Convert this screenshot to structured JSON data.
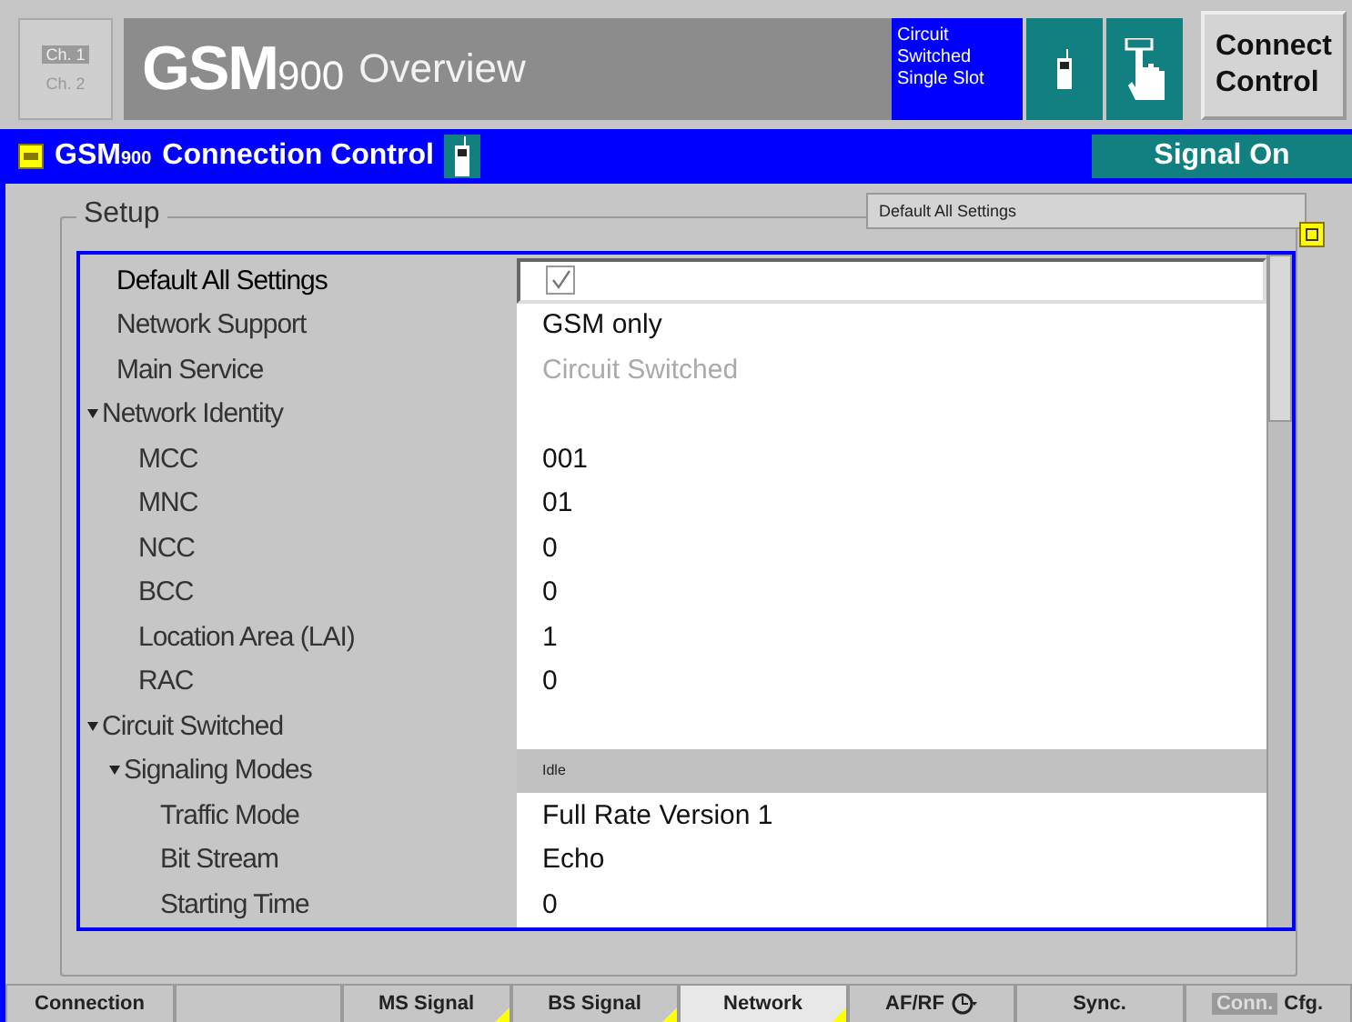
{
  "header": {
    "channels": [
      {
        "label": "Ch. 1",
        "selected": true
      },
      {
        "label": "Ch. 2",
        "selected": false
      }
    ],
    "title": "GSM",
    "title_band": "900",
    "subtitle": "Overview",
    "mode": "Circuit Switched Single Slot",
    "button": "Connect Control"
  },
  "menu_bar": {
    "title": "GSM",
    "title_band": "900",
    "name": "Connection Control",
    "signal": "Signal On"
  },
  "setup": {
    "legend": "Setup",
    "default_button": "Default All Settings",
    "rows": [
      {
        "label": "Default All Settings",
        "kind": "check",
        "checked": true,
        "selected": true
      },
      {
        "label": "Network Support",
        "kind": "text",
        "value": "GSM only",
        "disabled": false,
        "selected": false
      },
      {
        "label": "Main Service",
        "kind": "text",
        "value": "Circuit Switched",
        "disabled": true,
        "selected": false
      },
      {
        "label": "Network Identity",
        "kind": "group",
        "expanded": true,
        "selected": false,
        "children": [
          {
            "label": "MCC",
            "kind": "text",
            "value": "001",
            "disabled": false,
            "selected": false
          },
          {
            "label": "MNC",
            "kind": "text",
            "value": "01",
            "disabled": false,
            "selected": false
          },
          {
            "label": "NCC",
            "kind": "text",
            "value": "0",
            "disabled": false,
            "selected": false
          },
          {
            "label": "BCC",
            "kind": "text",
            "value": "0",
            "disabled": false,
            "selected": false
          },
          {
            "label": "Location Area (LAI)",
            "kind": "text",
            "value": "1",
            "disabled": false,
            "selected": false
          },
          {
            "label": "RAC",
            "kind": "text",
            "value": "0",
            "disabled": false,
            "selected": false
          }
        ]
      },
      {
        "label": "Circuit Switched",
        "kind": "group",
        "expanded": true,
        "selected": false,
        "children": [
          {
            "label": "Signaling Modes",
            "kind": "group",
            "value": "Idle",
            "expanded": true,
            "selected": false,
            "children": [
              {
                "label": "Traffic Mode",
                "kind": "text",
                "value": "Full Rate Version 1",
                "disabled": false,
                "selected": false
              },
              {
                "label": "Bit Stream",
                "kind": "text",
                "value": "Echo",
                "disabled": false,
                "selected": false
              },
              {
                "label": "Starting Time",
                "kind": "text",
                "value": "0",
                "disabled": false,
                "selected": false
              }
            ]
          }
        ]
      }
    ]
  },
  "tabs": [
    {
      "kind": "label",
      "label": "Connection",
      "selected": false,
      "marker": false
    },
    {
      "kind": "blank",
      "selected": false,
      "marker": false
    },
    {
      "kind": "label",
      "label": "MS Signal",
      "selected": false,
      "marker": true
    },
    {
      "kind": "label",
      "label": "BS Signal",
      "selected": false,
      "marker": true
    },
    {
      "kind": "label",
      "label": "Network",
      "selected": true,
      "marker": true
    },
    {
      "kind": "icon",
      "label": "AF/RF",
      "selected": false,
      "marker": false
    },
    {
      "kind": "label",
      "label": "Sync.",
      "selected": false,
      "marker": false
    },
    {
      "kind": "prefixed",
      "prefix": "Conn.",
      "label": "Cfg.",
      "selected": false,
      "marker": false
    }
  ]
}
